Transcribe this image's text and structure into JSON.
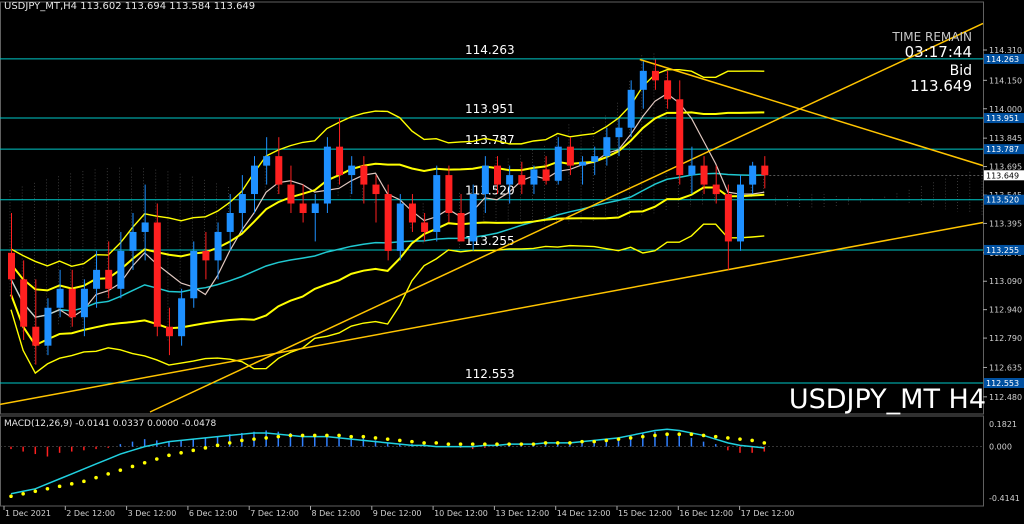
{
  "window": {
    "header_text": "USDJPY_MT,H4  113.602 113.694 113.584 113.649",
    "macd_header_text": "MACD(12,26,9) -0.0141 0.0337 0.0000 -0.0478",
    "watermark": "USDJPY_MT H4"
  },
  "timer": {
    "label": "TIME REMAIN",
    "value": "03:17:44"
  },
  "bid": {
    "label": "Bid",
    "value": "113.649"
  },
  "colors": {
    "background": "#000000",
    "bull_candle": "#1e90ff",
    "bear_candle": "#ff2020",
    "level_line": "#00c8c8",
    "bollinger": "#ffff00",
    "trendline": "#ffc400",
    "ma_teal": "#20c8d0",
    "ma_white": "#e0c8c0",
    "price_tag_bg": "#0050a0",
    "macd_hist": "#3080ff",
    "macd_signal": "#ffff00",
    "macd_line": "#20d0e0"
  },
  "horizontal_levels": [
    {
      "value": 114.263,
      "label": "114.263",
      "tag": "114.263"
    },
    {
      "value": 113.951,
      "label": "113.951",
      "tag": "113.951"
    },
    {
      "value": 113.787,
      "label": "113.787",
      "tag": "113.787"
    },
    {
      "value": 113.52,
      "label": "113.520",
      "tag": "113.520"
    },
    {
      "value": 113.255,
      "label": "113.255",
      "tag": "113.255"
    },
    {
      "value": 112.553,
      "label": "112.553",
      "tag": "112.553"
    }
  ],
  "current_price_tag": {
    "value": 113.649,
    "label": "113.649"
  },
  "chart_data": {
    "type": "candlestick",
    "price_axis": {
      "ticks": [
        "114.310",
        "114.150",
        "114.000",
        "113.845",
        "113.695",
        "113.545",
        "113.395",
        "113.240",
        "113.090",
        "112.940",
        "112.790",
        "112.635",
        "112.480"
      ],
      "range": [
        112.4,
        114.5
      ]
    },
    "time_axis": {
      "labels": [
        "1 Dec 2021",
        "2 Dec 12:00",
        "3 Dec 12:00",
        "6 Dec 12:00",
        "7 Dec 12:00",
        "8 Dec 12:00",
        "9 Dec 12:00",
        "10 Dec 12:00",
        "13 Dec 12:00",
        "14 Dec 12:00",
        "15 Dec 12:00",
        "16 Dec 12:00",
        "17 Dec 12:00"
      ]
    },
    "candles": [
      [
        113.24,
        113.45,
        113.0,
        113.1
      ],
      [
        113.1,
        113.2,
        112.78,
        112.85
      ],
      [
        112.85,
        113.1,
        112.65,
        112.75
      ],
      [
        112.75,
        113.0,
        112.7,
        112.95
      ],
      [
        112.95,
        113.15,
        112.9,
        113.05
      ],
      [
        113.05,
        113.15,
        112.85,
        112.9
      ],
      [
        112.9,
        113.1,
        112.8,
        113.05
      ],
      [
        113.05,
        113.25,
        112.95,
        113.15
      ],
      [
        113.15,
        113.3,
        113.0,
        113.05
      ],
      [
        113.05,
        113.35,
        113.0,
        113.25
      ],
      [
        113.25,
        113.45,
        113.15,
        113.35
      ],
      [
        113.35,
        113.6,
        113.2,
        113.4
      ],
      [
        113.4,
        113.5,
        112.8,
        112.85
      ],
      [
        112.85,
        112.95,
        112.7,
        112.8
      ],
      [
        112.8,
        113.05,
        112.75,
        113.0
      ],
      [
        113.0,
        113.3,
        112.95,
        113.25
      ],
      [
        113.25,
        113.35,
        113.1,
        113.2
      ],
      [
        113.2,
        113.4,
        113.1,
        113.35
      ],
      [
        113.35,
        113.55,
        113.25,
        113.45
      ],
      [
        113.45,
        113.65,
        113.35,
        113.55
      ],
      [
        113.55,
        113.75,
        113.45,
        113.7
      ],
      [
        113.7,
        113.85,
        113.6,
        113.75
      ],
      [
        113.75,
        113.85,
        113.55,
        113.6
      ],
      [
        113.6,
        113.7,
        113.45,
        113.5
      ],
      [
        113.5,
        113.6,
        113.4,
        113.45
      ],
      [
        113.45,
        113.55,
        113.3,
        113.5
      ],
      [
        113.5,
        113.85,
        113.45,
        113.8
      ],
      [
        113.8,
        113.95,
        113.6,
        113.65
      ],
      [
        113.65,
        113.75,
        113.55,
        113.7
      ],
      [
        113.7,
        113.75,
        113.5,
        113.6
      ],
      [
        113.6,
        113.65,
        113.4,
        113.55
      ],
      [
        113.55,
        113.6,
        113.2,
        113.25
      ],
      [
        113.25,
        113.55,
        113.2,
        113.5
      ],
      [
        113.5,
        113.55,
        113.35,
        113.4
      ],
      [
        113.4,
        113.45,
        113.3,
        113.35
      ],
      [
        113.35,
        113.7,
        113.3,
        113.65
      ],
      [
        113.65,
        113.7,
        113.4,
        113.45
      ],
      [
        113.45,
        113.55,
        113.3,
        113.3
      ],
      [
        113.3,
        113.6,
        113.25,
        113.55
      ],
      [
        113.55,
        113.75,
        113.45,
        113.7
      ],
      [
        113.7,
        113.75,
        113.55,
        113.6
      ],
      [
        113.6,
        113.7,
        113.5,
        113.65
      ],
      [
        113.65,
        113.72,
        113.55,
        113.6
      ],
      [
        113.6,
        113.7,
        113.55,
        113.68
      ],
      [
        113.68,
        113.75,
        113.6,
        113.62
      ],
      [
        113.62,
        113.85,
        113.6,
        113.8
      ],
      [
        113.8,
        113.85,
        113.65,
        113.7
      ],
      [
        113.7,
        113.75,
        113.6,
        113.72
      ],
      [
        113.72,
        113.8,
        113.65,
        113.75
      ],
      [
        113.75,
        113.9,
        113.7,
        113.85
      ],
      [
        113.85,
        113.95,
        113.75,
        113.9
      ],
      [
        113.9,
        114.15,
        113.85,
        114.1
      ],
      [
        114.1,
        114.25,
        114.0,
        114.2
      ],
      [
        114.2,
        114.26,
        114.1,
        114.15
      ],
      [
        114.15,
        114.2,
        114.0,
        114.05
      ],
      [
        114.05,
        114.15,
        113.6,
        113.65
      ],
      [
        113.65,
        113.8,
        113.55,
        113.7
      ],
      [
        113.7,
        113.75,
        113.55,
        113.6
      ],
      [
        113.6,
        113.7,
        113.5,
        113.55
      ],
      [
        113.55,
        113.6,
        113.15,
        113.3
      ],
      [
        113.3,
        113.65,
        113.25,
        113.6
      ],
      [
        113.6,
        113.72,
        113.55,
        113.7
      ],
      [
        113.7,
        113.75,
        113.58,
        113.649
      ]
    ],
    "macd": {
      "range": [
        -0.4141,
        0.1821
      ],
      "ticks": [
        "0.1821",
        "0.000",
        "-0.4141"
      ],
      "hist": [
        -0.02,
        -0.04,
        -0.06,
        -0.08,
        -0.05,
        -0.04,
        -0.03,
        -0.02,
        -0.01,
        0.02,
        0.04,
        0.06,
        0.05,
        0.04,
        0.05,
        0.06,
        0.07,
        0.08,
        0.1,
        0.11,
        0.12,
        0.13,
        0.12,
        0.11,
        0.1,
        0.09,
        0.1,
        0.09,
        0.08,
        0.07,
        0.05,
        0.03,
        0.02,
        0.02,
        0.01,
        0.0,
        0.01,
        -0.01,
        -0.02,
        -0.01,
        0.01,
        0.02,
        0.03,
        0.02,
        0.03,
        0.04,
        0.03,
        0.04,
        0.05,
        0.06,
        0.07,
        0.09,
        0.11,
        0.12,
        0.11,
        0.09,
        0.07,
        0.04,
        0.02,
        -0.03,
        -0.05,
        -0.05,
        -0.04
      ],
      "signal": [
        -0.4,
        -0.38,
        -0.36,
        -0.34,
        -0.32,
        -0.3,
        -0.28,
        -0.25,
        -0.22,
        -0.19,
        -0.16,
        -0.13,
        -0.1,
        -0.07,
        -0.05,
        -0.03,
        -0.01,
        0.01,
        0.03,
        0.05,
        0.06,
        0.07,
        0.08,
        0.09,
        0.09,
        0.09,
        0.09,
        0.09,
        0.08,
        0.08,
        0.07,
        0.06,
        0.05,
        0.04,
        0.03,
        0.03,
        0.02,
        0.02,
        0.02,
        0.02,
        0.02,
        0.02,
        0.02,
        0.02,
        0.03,
        0.03,
        0.03,
        0.04,
        0.04,
        0.05,
        0.06,
        0.07,
        0.08,
        0.09,
        0.1,
        0.1,
        0.1,
        0.09,
        0.08,
        0.07,
        0.06,
        0.05,
        0.03
      ],
      "line": [
        -0.38,
        -0.36,
        -0.34,
        -0.3,
        -0.26,
        -0.22,
        -0.18,
        -0.14,
        -0.1,
        -0.06,
        -0.03,
        0.0,
        0.02,
        0.04,
        0.05,
        0.06,
        0.07,
        0.08,
        0.09,
        0.1,
        0.11,
        0.11,
        0.1,
        0.09,
        0.08,
        0.08,
        0.08,
        0.07,
        0.06,
        0.05,
        0.04,
        0.03,
        0.02,
        0.01,
        0.01,
        0.0,
        0.0,
        0.0,
        0.0,
        0.01,
        0.01,
        0.02,
        0.02,
        0.02,
        0.03,
        0.03,
        0.03,
        0.04,
        0.05,
        0.06,
        0.07,
        0.09,
        0.11,
        0.13,
        0.14,
        0.13,
        0.11,
        0.09,
        0.06,
        0.03,
        0.01,
        0.0,
        -0.01
      ]
    }
  }
}
